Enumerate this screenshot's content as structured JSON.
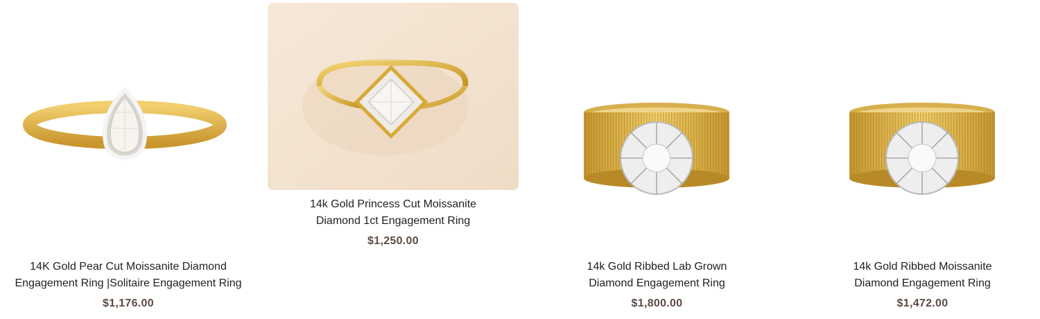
{
  "products": [
    {
      "title": "14K Gold Pear Cut Moissanite Diamond Engagement Ring |Solitaire Engagement Ring",
      "price": "$1,176.00",
      "image_alt": "pear-cut-ring-image"
    },
    {
      "title": "14k Gold Princess Cut Moissanite Diamond 1ct Engagement Ring",
      "price": "$1,250.00",
      "image_alt": "princess-cut-ring-image"
    },
    {
      "title": "14k Gold Ribbed Lab Grown Diamond Engagement Ring",
      "price": "$1,800.00",
      "image_alt": "ribbed-lab-grown-ring-image"
    },
    {
      "title": "14k Gold Ribbed Moissanite Diamond Engagement Ring",
      "price": "$1,472.00",
      "image_alt": "ribbed-moissanite-ring-image"
    }
  ],
  "colors": {
    "gold": "#e2b94d",
    "gold_dark": "#b8892a",
    "price_text": "#5d4a43",
    "beige_bg": "#f3e3d1"
  }
}
